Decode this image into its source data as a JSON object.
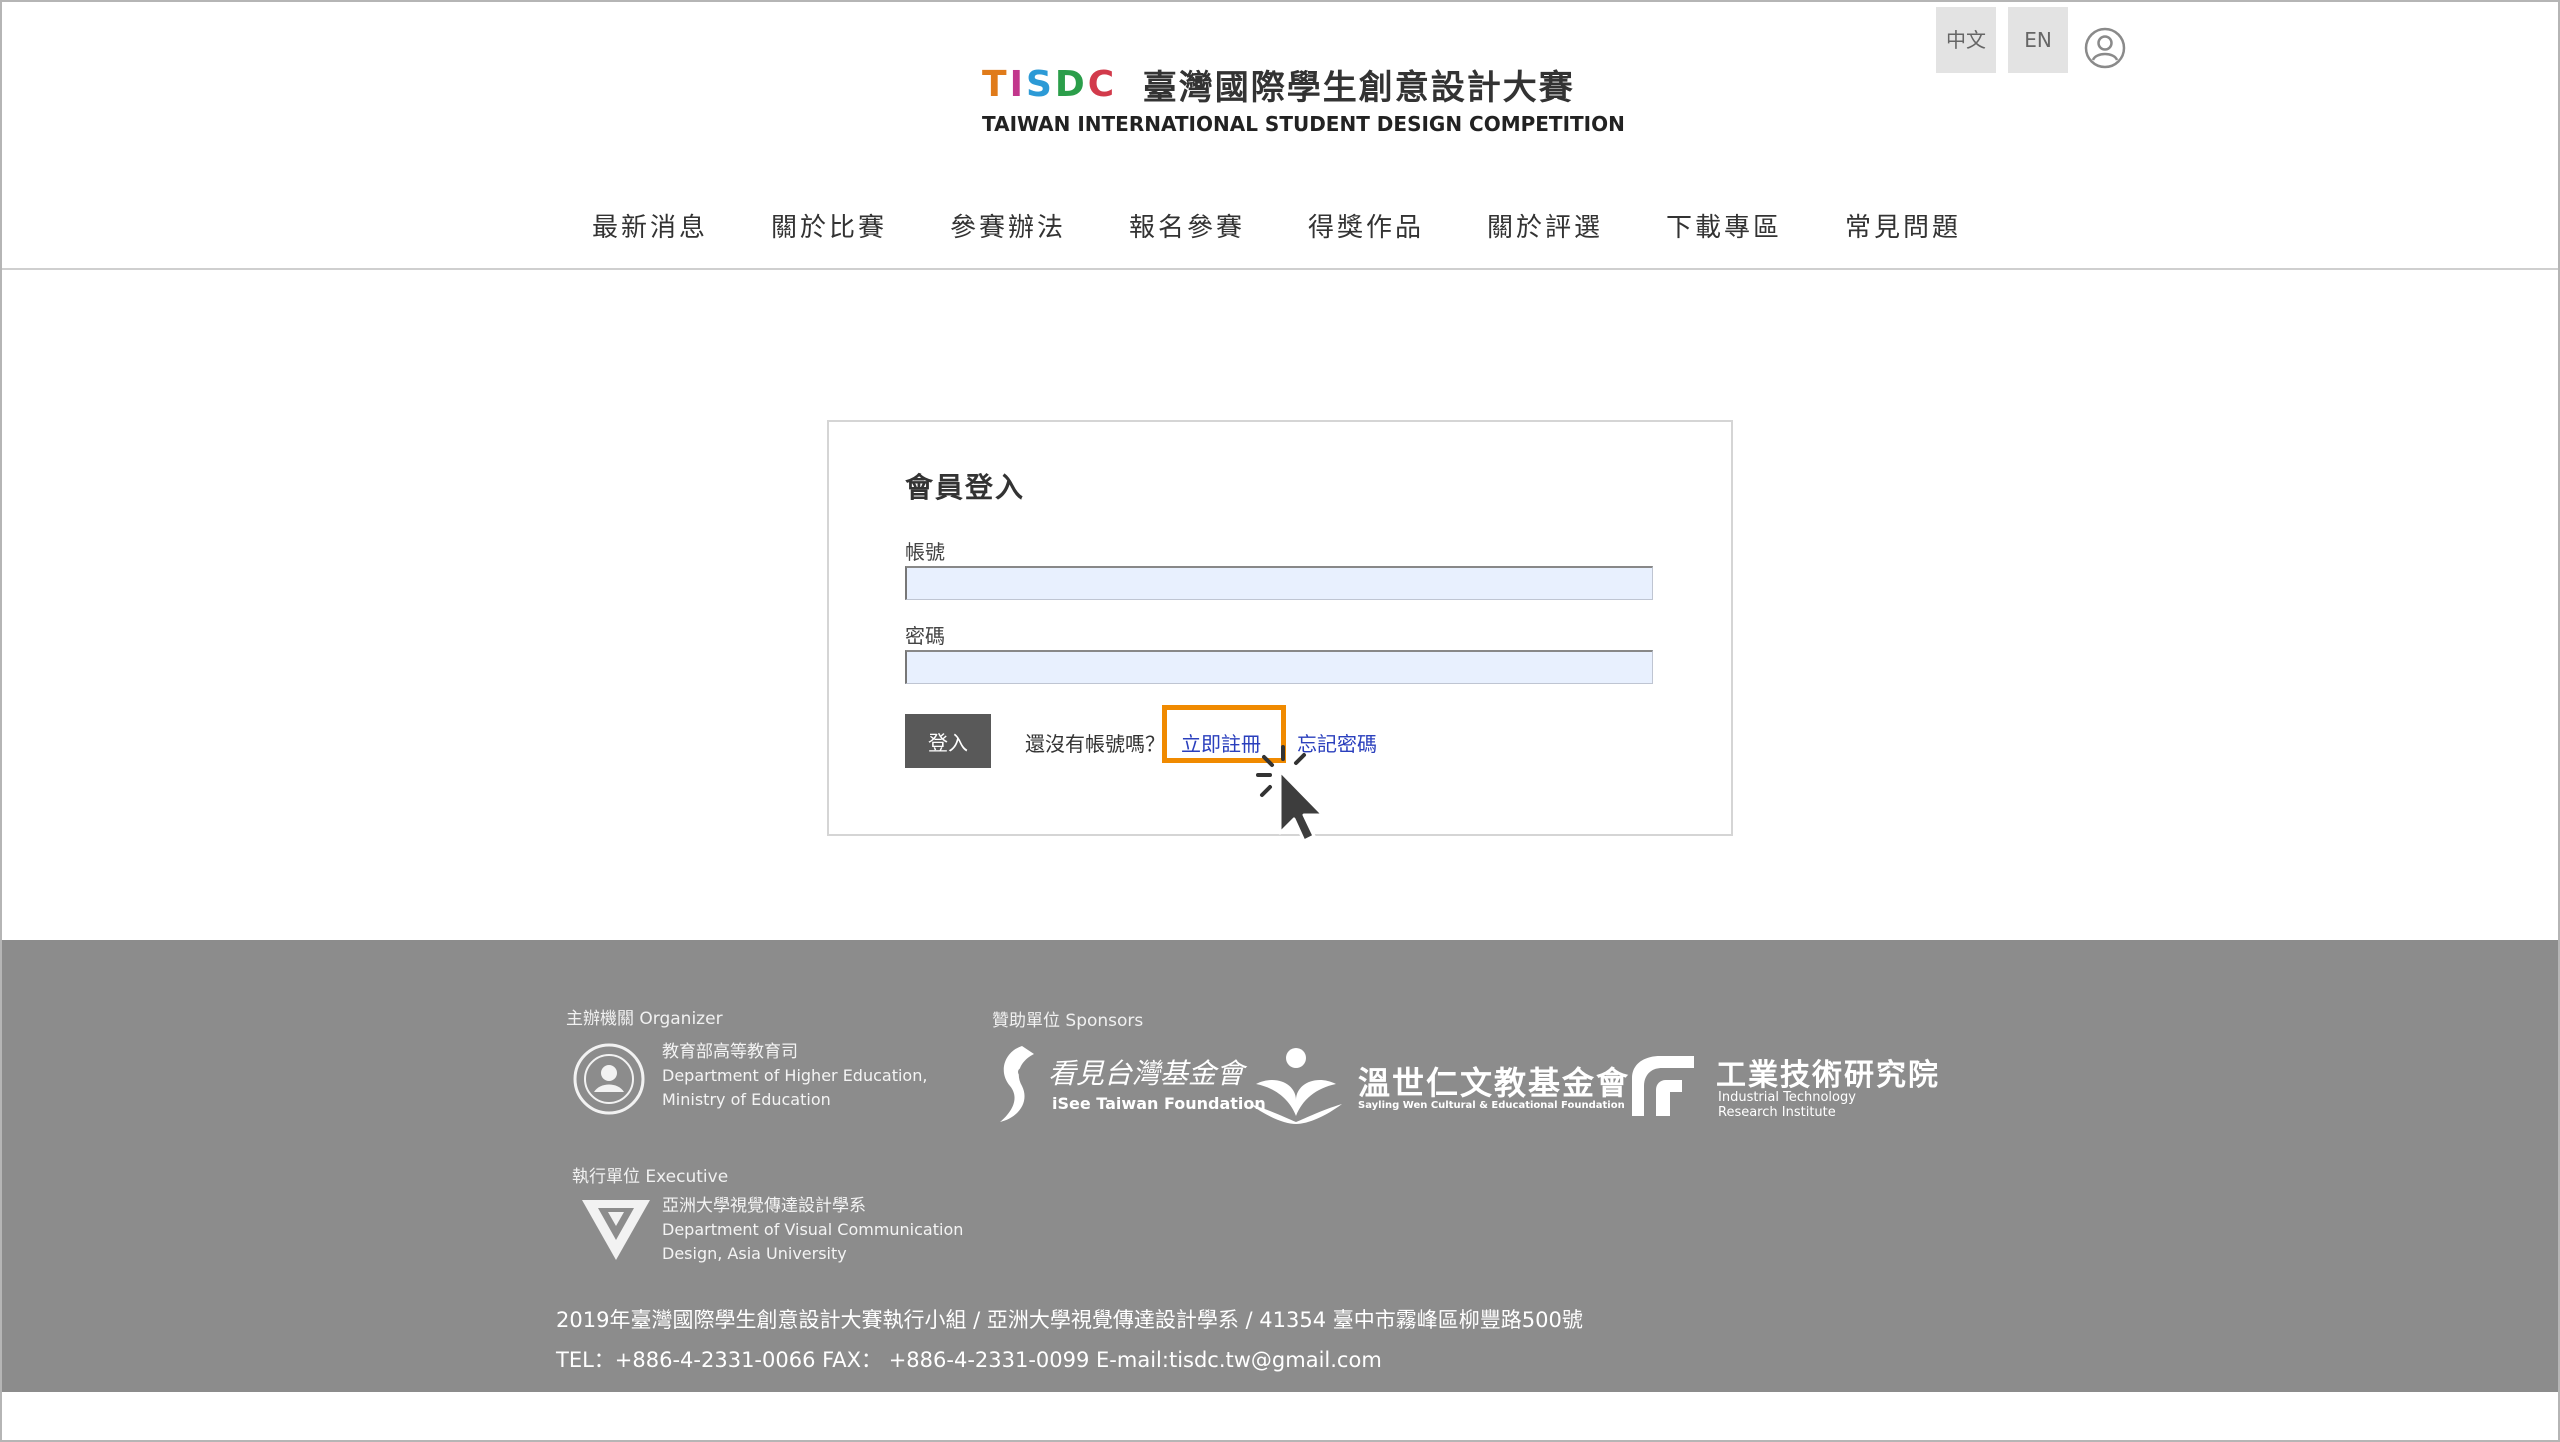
{
  "header": {
    "logo": {
      "abbr_letters": [
        "T",
        "I",
        "S",
        "D",
        "C"
      ],
      "abbr_colors": [
        "#e07b1a",
        "#c2378c",
        "#2c9ad6",
        "#2b9e4a",
        "#d23a4b"
      ],
      "title_zh": "臺灣國際學生創意設計大賽",
      "title_en": "TAIWAN INTERNATIONAL STUDENT DESIGN COMPETITION"
    },
    "lang_zh": "中文",
    "lang_en": "EN",
    "user_icon": "user-icon"
  },
  "nav": {
    "items": [
      {
        "label": "最新消息"
      },
      {
        "label": "關於比賽"
      },
      {
        "label": "參賽辦法"
      },
      {
        "label": "報名參賽"
      },
      {
        "label": "得獎作品"
      },
      {
        "label": "關於評選"
      },
      {
        "label": "下載專區"
      },
      {
        "label": "常見問題"
      }
    ]
  },
  "login": {
    "title": "會員登入",
    "account_label": "帳號",
    "account_value": "",
    "password_label": "密碼",
    "password_value": "",
    "submit_label": "登入",
    "no_account_text": "還沒有帳號嗎？",
    "register_link": "立即註冊",
    "forgot_link": "忘記密碼",
    "highlight_color": "#f08a00"
  },
  "footer": {
    "organizer_label": "主辦機關 Organizer",
    "organizer_name_zh": "教育部高等教育司",
    "organizer_name_en1": "Department of Higher Education,",
    "organizer_name_en2": "Ministry of Education",
    "sponsors_label": "贊助單位 Sponsors",
    "sponsor1_zh": "看見台灣基金會",
    "sponsor1_en": "iSee Taiwan Foundation",
    "sponsor2_zh": "溫世仁文教基金會",
    "sponsor2_en": "Sayling Wen Cultural & Educational Foundation",
    "sponsor3_zh": "工業技術研究院",
    "sponsor3_en1": "Industrial Technology",
    "sponsor3_en2": "Research Institute",
    "executive_label": "執行單位 Executive",
    "executive_name_zh": "亞洲大學視覺傳達設計學系",
    "executive_name_en1": "Department of Visual Communication",
    "executive_name_en2": "Design, Asia University",
    "address_line": "2019年臺灣國際學生創意設計大賽執行小組 / 亞洲大學視覺傳達設計學系 / 41354 臺中市霧峰區柳豐路500號",
    "contact_line": "TEL：+886-4-2331-0066 FAX： +886-4-2331-0099    E-mail:tisdc.tw@gmail.com",
    "background_color": "#8c8c8c"
  }
}
